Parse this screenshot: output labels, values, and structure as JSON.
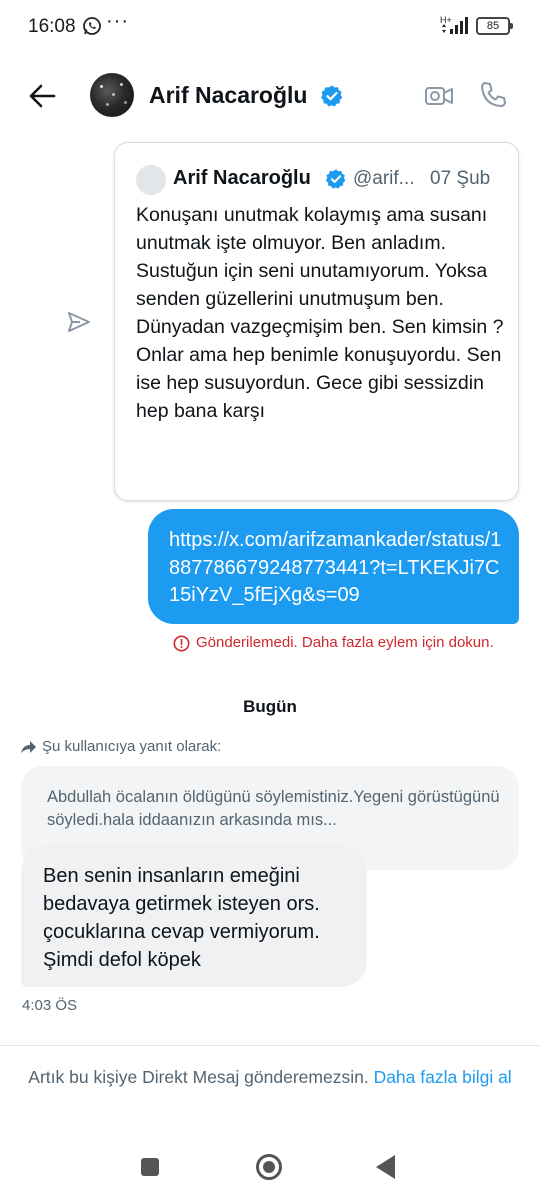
{
  "status_bar": {
    "time": "16:08",
    "dots": "···",
    "network": "H+",
    "battery": "85"
  },
  "header": {
    "name": "Arif Nacaroğlu",
    "verified_color": "#1d9bf0"
  },
  "conversation": {
    "quoted_tweet": {
      "name": "Arif Nacaroğlu",
      "handle": "@arif...",
      "date": "07 Şub",
      "text": "Konuşanı unutmak kolaymış ama susanı unutmak işte olmuyor.  Ben anladım. Sustuğun için seni unutamıyorum. Yoksa senden güzellerini unutmuşum ben. Dünyadan vazgeçmişim ben. Sen kimsin ? Onlar ama hep benimle konuşuyordu. Sen ise hep susuyordun. Gece gibi sessizdin hep bana karşı"
    },
    "sent_link": "https://x.com/arifzamankader/status/1887786679248773441?t=LTKEKJi7C15iYzV_5fEjXg&s=09",
    "send_failed_text": "Gönderilemedi. Daha fazla eylem için dokun.",
    "day_divider": "Bugün",
    "reply_label": "Şu kullanıcıya yanıt olarak:",
    "replied_to_text": "Abdullah öcalanın öldügünü söylemistiniz.Yegeni görüstügünü söyledi.hala iddaanızın arkasında mıs...",
    "received_message": "Ben senin insanların emeğini bedavaya getirmek isteyen ors. çocuklarına cevap vermiyorum. Şimdi defol köpek",
    "received_time": "4:03 ÖS"
  },
  "footer": {
    "notice": "Artık bu kişiye Direkt Mesaj gönderemezsin.",
    "learn_more": "Daha fazla bilgi al"
  },
  "colors": {
    "accent": "#1d9bf0",
    "error": "#d0282c",
    "secondary_text": "#536471"
  },
  "icons": {
    "back": "arrow-left-icon",
    "verified": "verified-badge-icon",
    "video": "video-camera-icon",
    "call": "phone-icon",
    "forward": "send-icon",
    "error": "error-circle-icon",
    "reply": "reply-arrow-icon"
  }
}
